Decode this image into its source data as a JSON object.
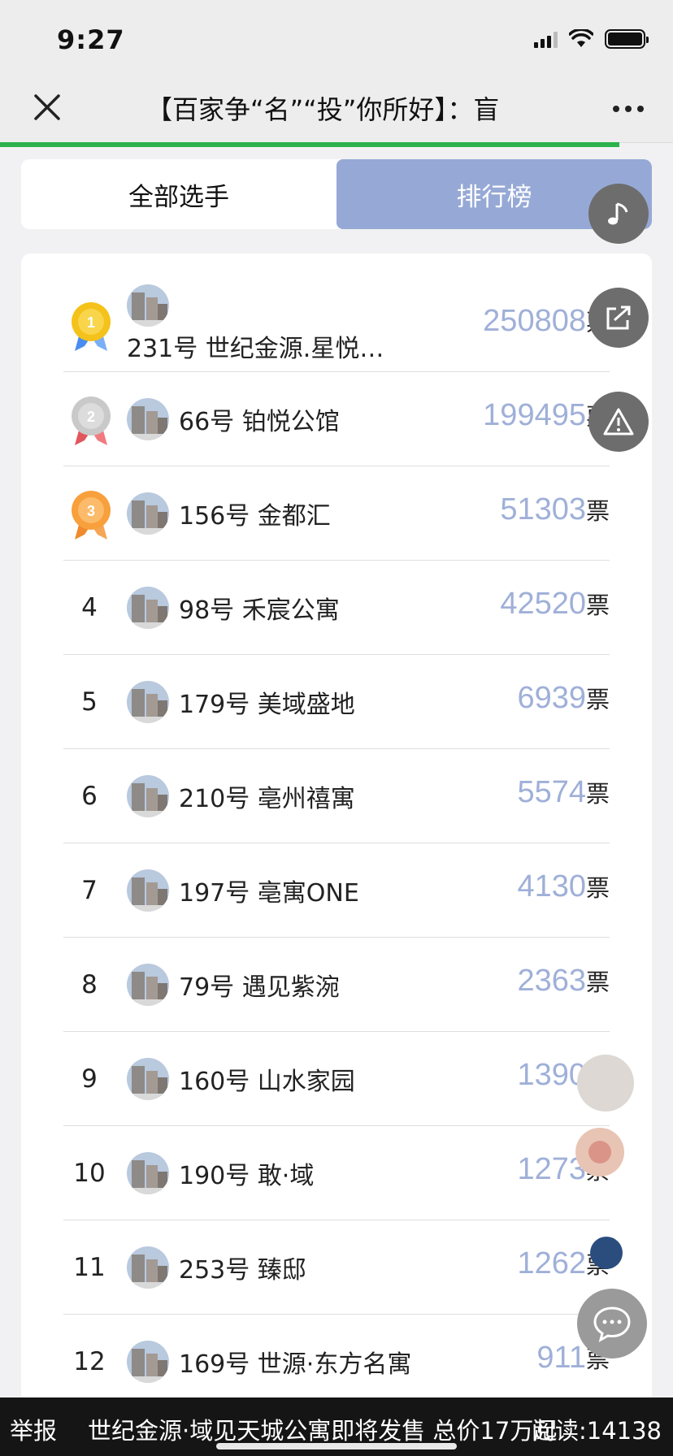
{
  "status_bar": {
    "time": "9:27"
  },
  "nav": {
    "title": "【百家争“名”“投”你所好】：盲"
  },
  "tabs": {
    "all": "全部选手",
    "ranking": "排行榜"
  },
  "ranking": [
    {
      "rank": "1",
      "name": "231号  世纪金源.星悦…",
      "votes": "250808",
      "unit": "票",
      "medal": "gold"
    },
    {
      "rank": "2",
      "name": "66号  铂悦公馆",
      "votes": "199495",
      "unit": "票",
      "medal": "silver"
    },
    {
      "rank": "3",
      "name": "156号  金都汇",
      "votes": "51303",
      "unit": "票",
      "medal": "bronze"
    },
    {
      "rank": "4",
      "name": "98号  禾宸公寓",
      "votes": "42520",
      "unit": "票"
    },
    {
      "rank": "5",
      "name": "179号  美域盛地",
      "votes": "6939",
      "unit": "票"
    },
    {
      "rank": "6",
      "name": "210号  亳州禧寓",
      "votes": "5574",
      "unit": "票"
    },
    {
      "rank": "7",
      "name": "197号  亳寓ONE",
      "votes": "4130",
      "unit": "票"
    },
    {
      "rank": "8",
      "name": "79号  遇见紫涴",
      "votes": "2363",
      "unit": "票"
    },
    {
      "rank": "9",
      "name": "160号  山水家园",
      "votes": "1390",
      "unit": "票"
    },
    {
      "rank": "10",
      "name": "190号  敢·域",
      "votes": "1273",
      "unit": "票"
    },
    {
      "rank": "11",
      "name": "253号  臻邸",
      "votes": "1262",
      "unit": "票"
    },
    {
      "rank": "12",
      "name": "169号  世源·东方名寓",
      "votes": "911",
      "unit": "票"
    }
  ],
  "ticker": {
    "report": "举报",
    "news": "世纪金源·域见天城公寓即将发售 总价17万起",
    "reads": "阅读:14138"
  },
  "icons": {
    "close": "close-icon",
    "more": "more-icon",
    "music": "music-note-icon",
    "share": "share-icon",
    "warning": "warning-icon",
    "chat": "chat-icon"
  },
  "colors": {
    "accent": "#96a9d6",
    "vote_number": "#9fb0d8",
    "progress": "#2bb24c",
    "gold": "#f4c21a",
    "silver": "#c9c9c9",
    "bronze": "#f7a03c"
  }
}
